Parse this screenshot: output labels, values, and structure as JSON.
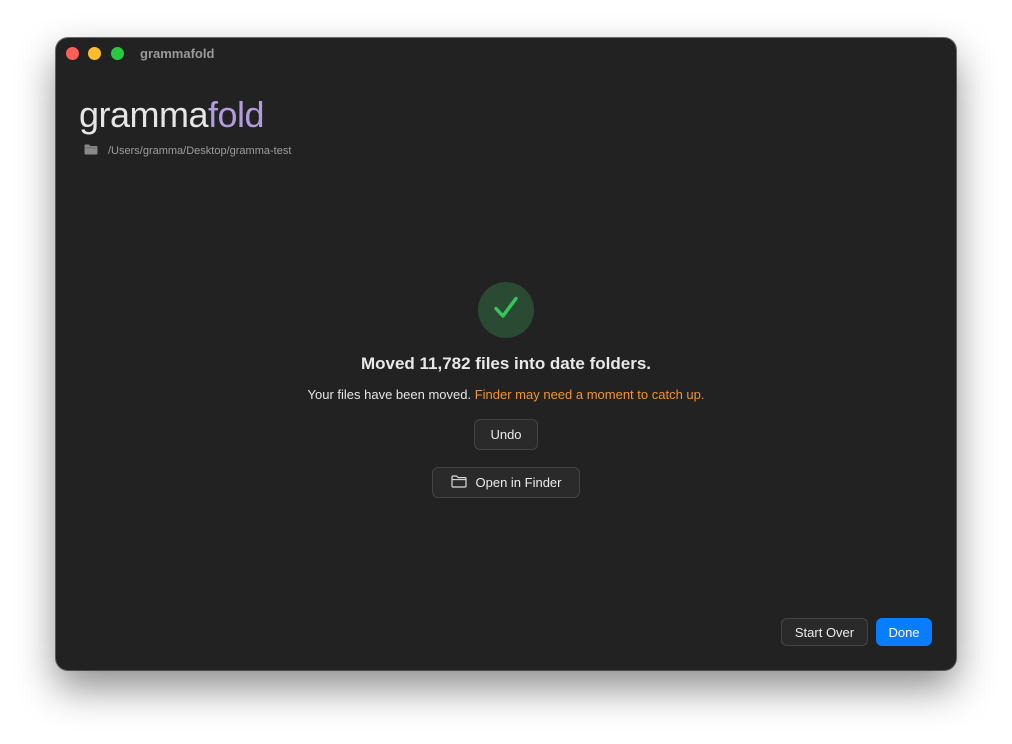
{
  "window": {
    "title": "grammafold"
  },
  "brand": {
    "part1": "gramma",
    "part2": "fold"
  },
  "path": {
    "icon": "folder-icon",
    "text": "/Users/gramma/Desktop/gramma-test"
  },
  "result": {
    "icon": "checkmark-icon",
    "headline": "Moved 11,782 files into date folders.",
    "message": "Your files have been moved.",
    "warning": "Finder may need a moment to catch up."
  },
  "actions": {
    "undo_label": "Undo",
    "open_finder_label": "Open in Finder",
    "start_over_label": "Start Over",
    "done_label": "Done"
  },
  "colors": {
    "accent_blue": "#0a7cff",
    "brand_purple": "#b39be0",
    "success_green": "#34c759",
    "warning_orange": "#f0952f",
    "window_bg": "#222222"
  }
}
